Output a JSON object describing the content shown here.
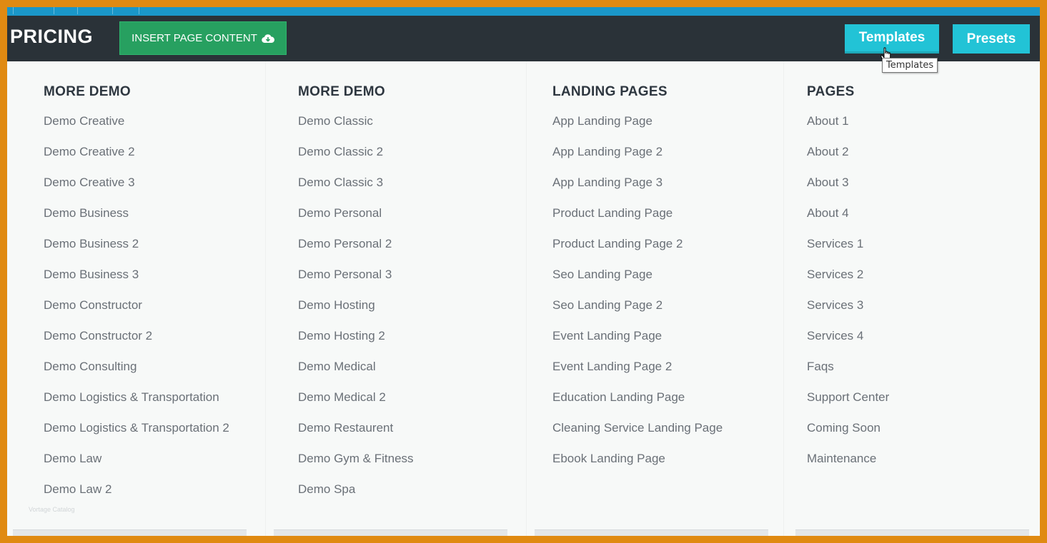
{
  "header": {
    "brand": "PRICING",
    "insert_label": "INSERT PAGE CONTENT",
    "templates_label": "Templates",
    "presets_label": "Presets",
    "tooltip": "Templates"
  },
  "columns": [
    {
      "title": "MORE DEMO",
      "items": [
        "Demo Creative",
        "Demo Creative 2",
        "Demo Creative 3",
        "Demo Business",
        "Demo Business 2",
        "Demo Business 3",
        "Demo Constructor",
        "Demo Constructor 2",
        "Demo Consulting",
        "Demo Logistics & Transportation",
        "Demo Logistics & Transportation 2",
        "Demo Law",
        "Demo Law 2"
      ]
    },
    {
      "title": "MORE DEMO",
      "items": [
        "Demo Classic",
        "Demo Classic 2",
        "Demo Classic 3",
        "Demo Personal",
        "Demo Personal 2",
        "Demo Personal 3",
        "Demo Hosting",
        "Demo Hosting 2",
        "Demo Medical",
        "Demo Medical 2",
        "Demo Restaurent",
        "Demo Gym & Fitness",
        "Demo Spa"
      ]
    },
    {
      "title": "LANDING PAGES",
      "items": [
        "App Landing Page",
        "App Landing Page 2",
        "App Landing Page 3",
        "Product Landing Page",
        "Product Landing Page 2",
        "Seo Landing Page",
        "Seo Landing Page 2",
        "Event Landing Page",
        "Event Landing Page 2",
        "Education Landing Page",
        "Cleaning Service Landing Page",
        "Ebook Landing Page"
      ]
    },
    {
      "title": "PAGES",
      "items": [
        "About 1",
        "About 2",
        "About 3",
        "About 4",
        "Services 1",
        "Services 2",
        "Services 3",
        "Services 4",
        "Faqs",
        "Support Center",
        "Coming Soon",
        "Maintenance"
      ]
    }
  ],
  "watermark": "Vortage Catalog",
  "colors": {
    "frame_border": "#e08a12",
    "header_bg": "#2a3238",
    "accent_cyan": "#22c3d6",
    "insert_green": "#27a060",
    "top_strip": "#1a97c9"
  },
  "icons": {
    "insert": "cloud-download-icon",
    "cursor": "hand-pointer-icon"
  }
}
